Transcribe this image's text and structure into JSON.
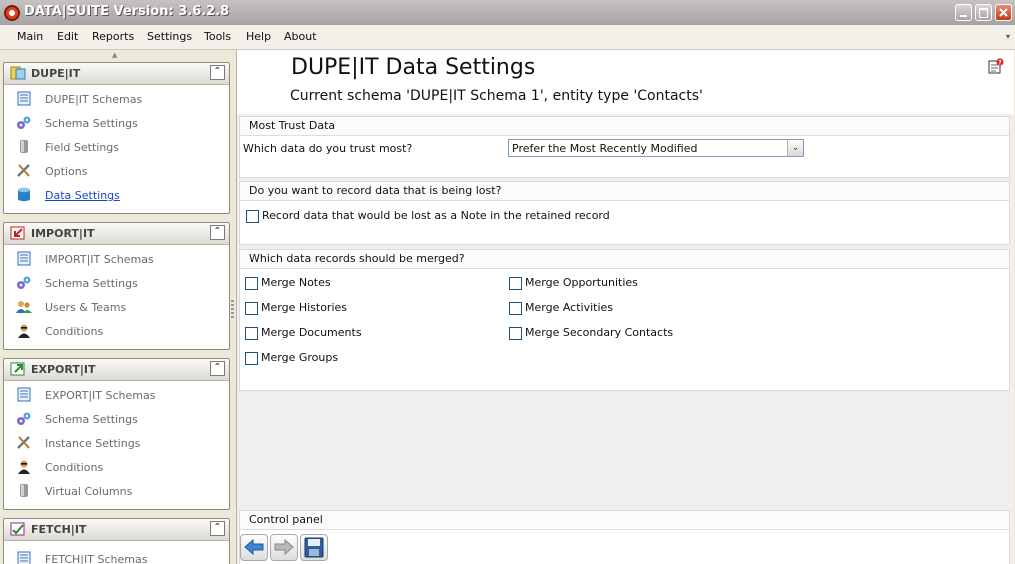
{
  "window": {
    "title": "DATA|SUITE Version: 3.6.2.8"
  },
  "menu": [
    "Main",
    "Edit",
    "Reports",
    "Settings",
    "Tools",
    "Help",
    "About"
  ],
  "sidebar": {
    "groups": [
      {
        "title": "DUPE|IT",
        "icon": "dupe-it-icon",
        "items": [
          {
            "label": "DUPE|IT Schemas",
            "icon": "schema-list-icon"
          },
          {
            "label": "Schema Settings",
            "icon": "schema-settings-icon"
          },
          {
            "label": "Field Settings",
            "icon": "field-settings-icon"
          },
          {
            "label": "Options",
            "icon": "tools-icon"
          },
          {
            "label": "Data Settings",
            "icon": "database-icon",
            "active": true
          }
        ]
      },
      {
        "title": "IMPORT|IT",
        "icon": "import-it-icon",
        "items": [
          {
            "label": "IMPORT|IT Schemas",
            "icon": "schema-list-icon"
          },
          {
            "label": "Schema Settings",
            "icon": "schema-settings-icon"
          },
          {
            "label": "Users & Teams",
            "icon": "users-icon"
          },
          {
            "label": "Conditions",
            "icon": "agent-icon"
          }
        ]
      },
      {
        "title": "EXPORT|IT",
        "icon": "export-it-icon",
        "items": [
          {
            "label": "EXPORT|IT Schemas",
            "icon": "schema-list-icon"
          },
          {
            "label": "Schema Settings",
            "icon": "schema-settings-icon"
          },
          {
            "label": "Instance Settings",
            "icon": "tools-icon"
          },
          {
            "label": "Conditions",
            "icon": "agent-icon"
          },
          {
            "label": "Virtual Columns",
            "icon": "field-settings-icon"
          }
        ]
      },
      {
        "title": "FETCH|IT",
        "icon": "fetch-it-icon",
        "items": [
          {
            "label": "FETCH|IT Schemas",
            "icon": "schema-list-icon"
          }
        ]
      }
    ]
  },
  "main": {
    "title": "DUPE|IT Data Settings",
    "subtitle": "Current schema 'DUPE|IT Schema 1', entity type 'Contacts'",
    "trust": {
      "header": "Most Trust Data",
      "question": "Which data do you trust most?",
      "selected": "Prefer the Most Recently Modified"
    },
    "lost": {
      "header": "Do you want to record data that is being lost?",
      "checkbox_label": "Record data that would be lost as a Note in the retained record",
      "checked": false
    },
    "merge": {
      "header": "Which data records should be merged?",
      "left": [
        {
          "label": "Merge Notes",
          "checked": false
        },
        {
          "label": "Merge Histories",
          "checked": false
        },
        {
          "label": "Merge Documents",
          "checked": false
        },
        {
          "label": "Merge Groups",
          "checked": false
        }
      ],
      "right": [
        {
          "label": "Merge Opportunities",
          "checked": false
        },
        {
          "label": "Merge Activities",
          "checked": false
        },
        {
          "label": "Merge Secondary Contacts",
          "checked": false
        }
      ]
    },
    "control_panel": {
      "header": "Control panel"
    }
  },
  "colors": {
    "link_active": "#1a45c8",
    "panel_bg": "#F0EEEE",
    "sidebar_bg": "#ECE9D8"
  }
}
